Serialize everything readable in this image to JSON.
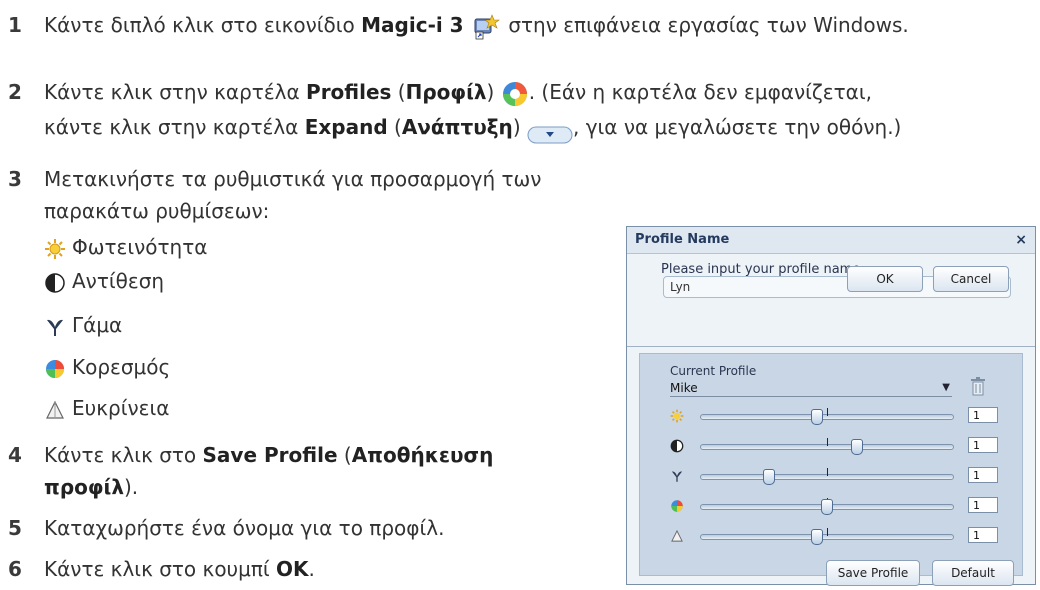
{
  "steps": {
    "s1": {
      "num": "1",
      "pre": "Κάντε διπλό κλικ στο εικονίδιο ",
      "bold": "Magic-i 3",
      "post": " στην επιφάνεια εργασίας των Windows."
    },
    "s2": {
      "num": "2",
      "pre": "Κάντε κλικ στην καρτέλα ",
      "b1": "Profiles",
      "mid1": " (",
      "b2": "Προφίλ",
      "mid2": ") ",
      "post": ". (Εάν η καρτέλα δεν εμφανίζεται,",
      "line2_pre": "κάντε κλικ στην καρτέλα ",
      "b3": "Expand",
      "mid3": " (",
      "b4": "Ανάπτυξη",
      "mid4": ") ",
      "line2_post": ", για να μεγαλώσετε την οθόνη.)"
    },
    "s3": {
      "num": "3",
      "line1": "Μετακινήστε τα ρυθμιστικά για προσαρμογή των",
      "line2": "παρακάτω ρυθμίσεων:",
      "items": [
        "Φωτεινότητα",
        "Αντίθεση",
        "Γάμα",
        "Κορεσμός",
        "Ευκρίνεια"
      ]
    },
    "s4": {
      "num": "4",
      "pre": "Κάντε κλικ στο ",
      "b1": "Save Profile",
      "mid": " (",
      "b2": "Αποθήκευση",
      "b3": "προφίλ",
      "post": ")."
    },
    "s5": {
      "num": "5",
      "text": "Καταχωρήστε ένα όνομα για το προφίλ."
    },
    "s6": {
      "num": "6",
      "pre": "Κάντε κλικ στο κουμπί ",
      "b1": "OK",
      "post": "."
    }
  },
  "dialog": {
    "title": "Profile Name",
    "close": "×",
    "prompt": "Please input your profile name:",
    "input_value": "Lyn",
    "ok_label": "OK",
    "cancel_label": "Cancel",
    "current_profile_label": "Current Profile",
    "current_profile_value": "Mike",
    "dropdown_arrow": "▼",
    "sliders": [
      {
        "name": "brightness",
        "icon": "sun-icon",
        "level": 0.46,
        "value": "1"
      },
      {
        "name": "contrast",
        "icon": "contrast-icon",
        "level": 0.62,
        "value": "1"
      },
      {
        "name": "gamma",
        "icon": "gamma-icon",
        "level": 0.27,
        "value": "1"
      },
      {
        "name": "saturation",
        "icon": "color-wheel-icon",
        "level": 0.5,
        "value": "1"
      },
      {
        "name": "sharpness",
        "icon": "triangle-icon",
        "level": 0.46,
        "value": "1"
      }
    ],
    "save_profile_label": "Save Profile",
    "default_label": "Default"
  },
  "colors": {
    "accent": "#243a5e",
    "panel": "#c9d6e5"
  }
}
